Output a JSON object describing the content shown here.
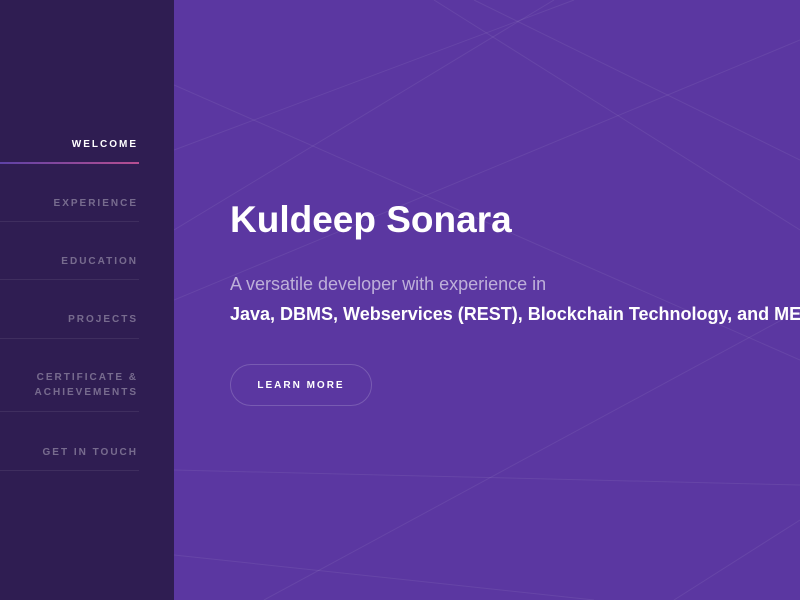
{
  "sidebar": {
    "items": [
      {
        "label": "WELCOME",
        "active": true
      },
      {
        "label": "EXPERIENCE",
        "active": false
      },
      {
        "label": "EDUCATION",
        "active": false
      },
      {
        "label": "PROJECTS",
        "active": false
      },
      {
        "label": "CERTIFICATE &",
        "label_line2": "ACHIEVEMENTS",
        "active": false
      },
      {
        "label": "GET IN TOUCH",
        "active": false
      }
    ]
  },
  "hero": {
    "title": "Kuldeep Sonara",
    "intro": "A versatile developer with experience in",
    "skills": "Java, DBMS, Webservices (REST), Blockchain Technology, and MER",
    "button_label": "LEARN MORE"
  },
  "colors": {
    "background": "#5b37a1",
    "sidebar": "#2f1d52",
    "accent_gradient_start": "#5e42a6",
    "accent_gradient_end": "#b74e91",
    "text": "#ffffff"
  }
}
